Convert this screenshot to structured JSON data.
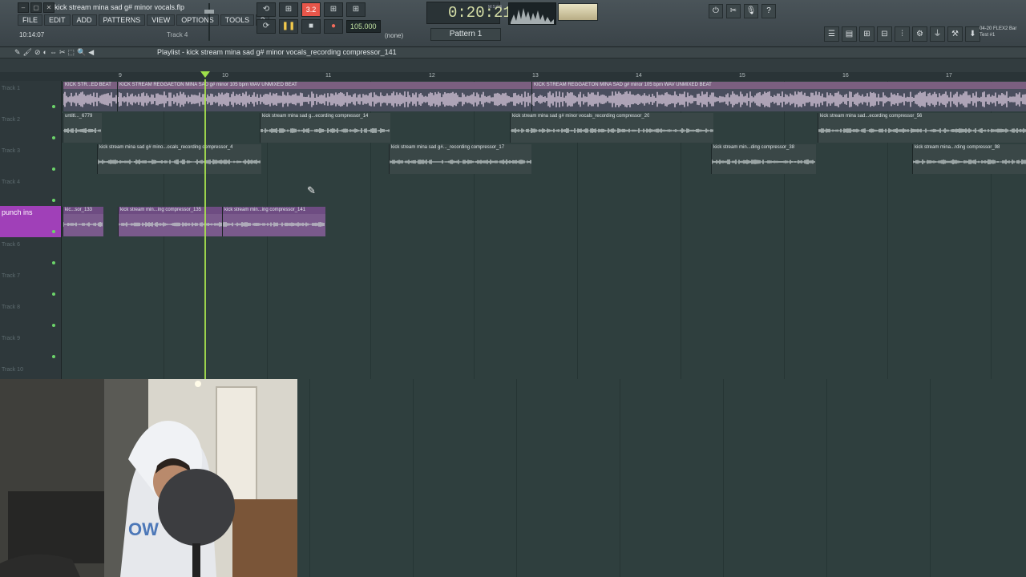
{
  "window": {
    "file_title": "kick stream mina sad g# minor vocals.flp",
    "time_small": "10:14:07",
    "hint_track": "Track 4",
    "menu": [
      "FILE",
      "EDIT",
      "ADD",
      "PATTERNS",
      "VIEW",
      "OPTIONS",
      "TOOLS",
      "?"
    ]
  },
  "transport": {
    "buttons": [
      "⟲",
      "⊞",
      "3.2",
      "⊞",
      "⊞"
    ],
    "tempo": "105.000",
    "time_main": "0:20:21",
    "time_unit": "M:S:CS",
    "pattern": "Pattern 1",
    "none_label": "(none)"
  },
  "right_header": {
    "flex_line1": "04-20 FLEX2 Bar",
    "flex_line2": "Test #1"
  },
  "playlist": {
    "title": "Playlist - kick stream mina sad g# minor vocals_recording compressor_141",
    "ruler_numbers": [
      "9",
      "10",
      "11",
      "12",
      "13",
      "14",
      "15",
      "16",
      "17"
    ],
    "tracks": [
      {
        "label": "Track 1",
        "highlight": false
      },
      {
        "label": "Track 2",
        "highlight": false
      },
      {
        "label": "Track 3",
        "highlight": false
      },
      {
        "label": "Track 4",
        "highlight": false
      },
      {
        "label": "punch ins",
        "highlight": true
      },
      {
        "label": "Track 6",
        "highlight": false
      },
      {
        "label": "Track 7",
        "highlight": false
      },
      {
        "label": "Track 8",
        "highlight": false
      },
      {
        "label": "Track 9",
        "highlight": false
      },
      {
        "label": "Track 10",
        "highlight": false
      }
    ],
    "clips": [
      {
        "track": 0,
        "name": "KICK STR...ED BEAT",
        "kind": "pink"
      },
      {
        "track": 0,
        "name": "KICK STREAM REGGAETON MINA SAD g# minor 105 bpm WAV UNMIXED BEAT",
        "kind": "pink"
      },
      {
        "track": 0,
        "name": "KICK STREAM REGGAETON MINA SAD g# minor 105 bpm WAV UNMIXED BEAT",
        "kind": "pink"
      },
      {
        "track": 1,
        "name": "untitl..._6779",
        "kind": "grey"
      },
      {
        "track": 1,
        "name": "kick stream mina sad g...ecording compressor_14",
        "kind": "grey"
      },
      {
        "track": 1,
        "name": "kick stream mina sad g# minor vocals_recording compressor_20",
        "kind": "grey"
      },
      {
        "track": 1,
        "name": "kick stream mina sad...ecording compressor_56",
        "kind": "grey"
      },
      {
        "track": 2,
        "name": "kick stream mina sad g# mino...ocals_recording compressor_4",
        "kind": "grey"
      },
      {
        "track": 2,
        "name": "kick stream mina sad g#..._recording compressor_17",
        "kind": "grey"
      },
      {
        "track": 2,
        "name": "kick stream min...ding compressor_38",
        "kind": "grey"
      },
      {
        "track": 2,
        "name": "kick stream mina...rding compressor_98",
        "kind": "grey"
      },
      {
        "track": 4,
        "name": "kic...sor_133",
        "kind": "purple"
      },
      {
        "track": 4,
        "name": "kick stream min...ing compressor_135",
        "kind": "purple"
      },
      {
        "track": 4,
        "name": "kick stream min...ing compressor_141",
        "kind": "purple"
      }
    ]
  },
  "colors": {
    "accent_green": "#a8e24e",
    "punch_track": "#a040b8",
    "record_red": "#e8564a"
  }
}
